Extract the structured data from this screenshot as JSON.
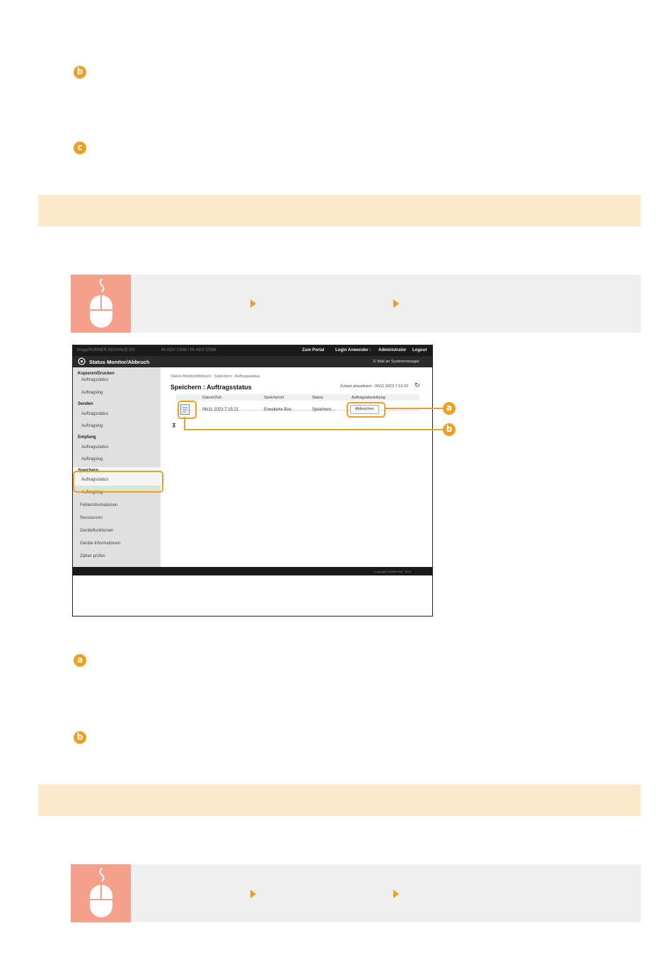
{
  "badges": {
    "a": "a",
    "b": "b",
    "c": "c"
  },
  "colors": {
    "accent": "#f0a020",
    "band": "#fde9cc",
    "operation_box": "#efefef",
    "mouse_icon_bg": "#f5a08a"
  },
  "icons": {
    "mouse": "mouse-icon",
    "arrow": "arrow-right-icon",
    "details": "document-details-icon"
  },
  "screenshot": {
    "top_bar": {
      "product": "imageRUNNER ADVANCE DX",
      "host1": "iR-ADV C568 / iR-ADV C568",
      "links": [
        "Zum Portal",
        "Login Anwender :",
        "Administrator",
        "Logout"
      ]
    },
    "title": "Status Monitor/Abbruch",
    "mail_link": "E-Mail an Systemmanager",
    "sidebar": {
      "sections": [
        {
          "title": "Kopieren/Drucken",
          "items": [
            "Auftragsstatus",
            "Auftragslog"
          ]
        },
        {
          "title": "Senden",
          "items": [
            "Auftragsstatus",
            "Auftragslog"
          ]
        },
        {
          "title": "Empfang",
          "items": [
            "Auftragsstatus",
            "Auftragslog"
          ]
        },
        {
          "title": "Speichern",
          "items": [
            "Auftragsstatus",
            "Auftragslog"
          ]
        }
      ],
      "extra_items": [
        "Fehlerinformationen",
        "Ressourcen",
        "Geräteﬂunktionen",
        "Geräte-Informationen",
        "Zähler prüfen"
      ]
    },
    "breadcrumb": "Status Monitor/Abbruch : Speichern : Auftragsstatus",
    "page_title": "Speichern : Auftragsstatus",
    "last_updated": "Zuletzt aktualisiert : 06/11 2023 7:15:29",
    "table": {
      "headers": [
        "Datum/Zeit",
        "Speicherort",
        "Status",
        "Auftragsabwicklung"
      ],
      "row": {
        "datetime": "06/11 2023 7:15:21",
        "location": "Erweiterte Box",
        "status": "Speichern...",
        "action": "Abbrechen"
      }
    },
    "pager": "⊼",
    "copyright": "Copyright CANON INC. 2023"
  }
}
